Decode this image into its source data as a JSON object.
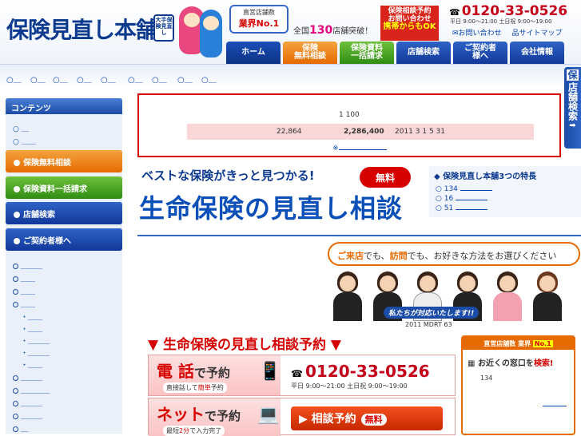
{
  "header": {
    "logo": "保険見直し本舗",
    "seal": "大手保険見直し",
    "badge_small": "直営店舗数",
    "badge_big": "業界No.1",
    "stores_prefix": "全国",
    "stores_count": "130",
    "stores_suffix": "店舗突破！",
    "cta_line1": "保険相談予約",
    "cta_line2": "お問い合わせ",
    "cta_line3": "携帯からもOK",
    "phone": "0120-33-0526",
    "phone_icon": "phone-icon",
    "hours": "平日 9:00～21:00  土日祝 9:00～19:00",
    "link_contact": "お問い合わせ",
    "link_sitemap": "サイトマップ"
  },
  "nav": [
    {
      "label": "ホーム"
    },
    {
      "label": "保険\n無料相談"
    },
    {
      "label": "保険資料\n一括請求"
    },
    {
      "label": "店舗検索"
    },
    {
      "label": "ご契約者\n様へ"
    },
    {
      "label": "会社情報"
    }
  ],
  "breadcrumb": [
    "○＿",
    "○＿",
    "○＿",
    "○＿",
    "○＿",
    "○＿",
    "○＿",
    "○＿",
    "○＿"
  ],
  "sidebar": {
    "title": "コンテンツ",
    "top_links": [
      "○ ＿",
      "○ ＿＿"
    ],
    "buttons": [
      "保険無料相談",
      "保険資料一括請求",
      "店舗検索",
      "ご契約者様へ"
    ],
    "links": [
      "＿＿＿",
      "＿＿",
      "＿＿",
      "＿＿",
      "・＿＿",
      "・＿＿",
      "・＿＿＿",
      "・＿＿＿",
      "・＿＿",
      "＿＿＿",
      "＿＿＿＿",
      "＿＿＿",
      "＿＿＿",
      "＿"
    ]
  },
  "notice": {
    "row1": "1    100",
    "row2_a": "22,864",
    "row2_b": "2,286,400",
    "row2_c": "2011 3 1  5 31",
    "row3": "※"
  },
  "vertical_tab": {
    "top": "保",
    "text": "店舗検索"
  },
  "hero": {
    "tagline": "ベストな保険がきっと見つかる!",
    "headline": "生命保険の見直し相談",
    "free_badge": "無料"
  },
  "features": {
    "title": "◆ 保険見直し本舗3つの特長",
    "items": [
      "134",
      "16",
      "51"
    ]
  },
  "visit": {
    "a": "ご来店",
    "b": "でも、",
    "c": "訪問",
    "d": "でも、お好きな方法をお選びください",
    "staff": "私たちが対応いたします!!",
    "mdrt": "2011  MDRT         63"
  },
  "reservation": {
    "heading": "▼ 生命保険の見直し相談予約 ▼",
    "tel_big": "電 話",
    "tel_big2": "で予約",
    "tel_sub_a": "直接話して",
    "tel_sub_b": "簡単",
    "tel_sub_c": "予約",
    "phone": "0120-33-0526",
    "hours": "平日 9:00～21:00   土日祝 9:00～19:00",
    "net_big": "ネット",
    "net_big2": "で予約",
    "net_sub_a": "最短",
    "net_sub_b": "2分",
    "net_sub_c": "で入力完了",
    "button": "▶ 相談予約",
    "button_badge": "無料"
  },
  "store_panel": {
    "top": "直営店舗数 業界",
    "top_badge": "No.1",
    "q_a": "お近くの窓口を",
    "q_b": "検索!",
    "count": "134"
  },
  "colors": {
    "brand": "#0b3a8f",
    "accent": "#d60000",
    "orange": "#e66a00"
  }
}
